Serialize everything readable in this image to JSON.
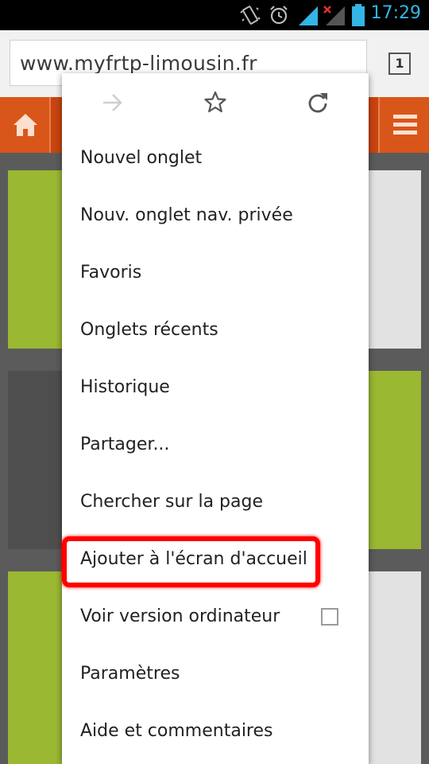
{
  "status_bar": {
    "time": "17:29",
    "icons": [
      "vibrate-icon",
      "alarm-icon",
      "signal-icon",
      "no-signal-icon",
      "battery-icon"
    ]
  },
  "browser": {
    "url": "www.myfrtp-limousin.fr",
    "tab_count": "1"
  },
  "site": {
    "brand_color": "#c94410",
    "tile_green": "#9ab832",
    "tile_gray": "#e2e2e2",
    "tile_dark": "#4e4e4e"
  },
  "menu": {
    "toolbar_icons": [
      "forward-icon",
      "star-icon",
      "reload-icon"
    ],
    "items": [
      {
        "label": "Nouvel onglet"
      },
      {
        "label": "Nouv. onglet nav. privée"
      },
      {
        "label": "Favoris"
      },
      {
        "label": "Onglets récents"
      },
      {
        "label": "Historique"
      },
      {
        "label": "Partager..."
      },
      {
        "label": "Chercher sur la page"
      },
      {
        "label": "Ajouter à l'écran d'accueil"
      },
      {
        "label": "Voir version ordinateur"
      },
      {
        "label": "Paramètres"
      },
      {
        "label": "Aide et commentaires"
      }
    ],
    "desktop_version_checked": false,
    "highlight_color": "#ff0000"
  }
}
